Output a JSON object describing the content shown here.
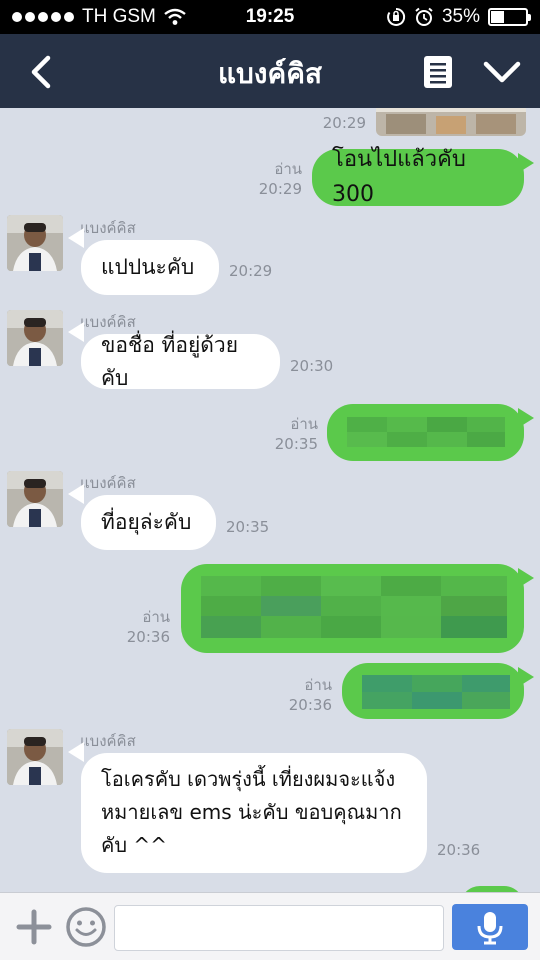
{
  "status_bar": {
    "carrier": "TH GSM",
    "time": "19:25",
    "battery": "35%",
    "battery_level": 0.35
  },
  "header": {
    "title": "แบงค์คิส",
    "back_icon": "chevron-left-icon",
    "notes_icon": "note-icon",
    "menu_icon": "chevron-down-icon"
  },
  "messages": [
    {
      "side": "left",
      "time": "20:29",
      "type": "image-partial"
    },
    {
      "side": "right",
      "read": "อ่าน",
      "time": "20:29",
      "text": "โอนไปแล้วคับ 300"
    },
    {
      "side": "left",
      "sender": "แบงค์คิส",
      "time": "20:29",
      "text": "แปปนะคับ"
    },
    {
      "side": "left",
      "sender": "แบงค์คิส",
      "time": "20:30",
      "text": "ขอชื่อ ที่อยู่ด้วยคับ"
    },
    {
      "side": "right",
      "read": "อ่าน",
      "time": "20:35",
      "type": "censored"
    },
    {
      "side": "left",
      "sender": "แบงค์คิส",
      "time": "20:35",
      "text": "ที่อยุล่ะคับ"
    },
    {
      "side": "right",
      "read": "อ่าน",
      "time": "20:36",
      "type": "censored"
    },
    {
      "side": "right",
      "read": "อ่าน",
      "time": "20:36",
      "type": "censored"
    },
    {
      "side": "left",
      "sender": "แบงค์คิส",
      "time": "20:36",
      "lines": [
        "โอเครคับ เดวพรุ่งนี้ เที่ยงผมจะแจ้ง",
        "หมายเลข ems น่ะคับ ขอบคุณมาก",
        "คับ ^^"
      ]
    }
  ],
  "colors": {
    "header": "#273246",
    "chat_background": "#d8dde7",
    "bubble_sent": "#5bc94b",
    "bubble_received": "#ffffff",
    "mic_button": "#4a82dd"
  },
  "input_bar": {
    "plus_icon": "plus-icon",
    "emoji_icon": "emoji-icon",
    "mic_icon": "microphone-icon",
    "placeholder": ""
  }
}
